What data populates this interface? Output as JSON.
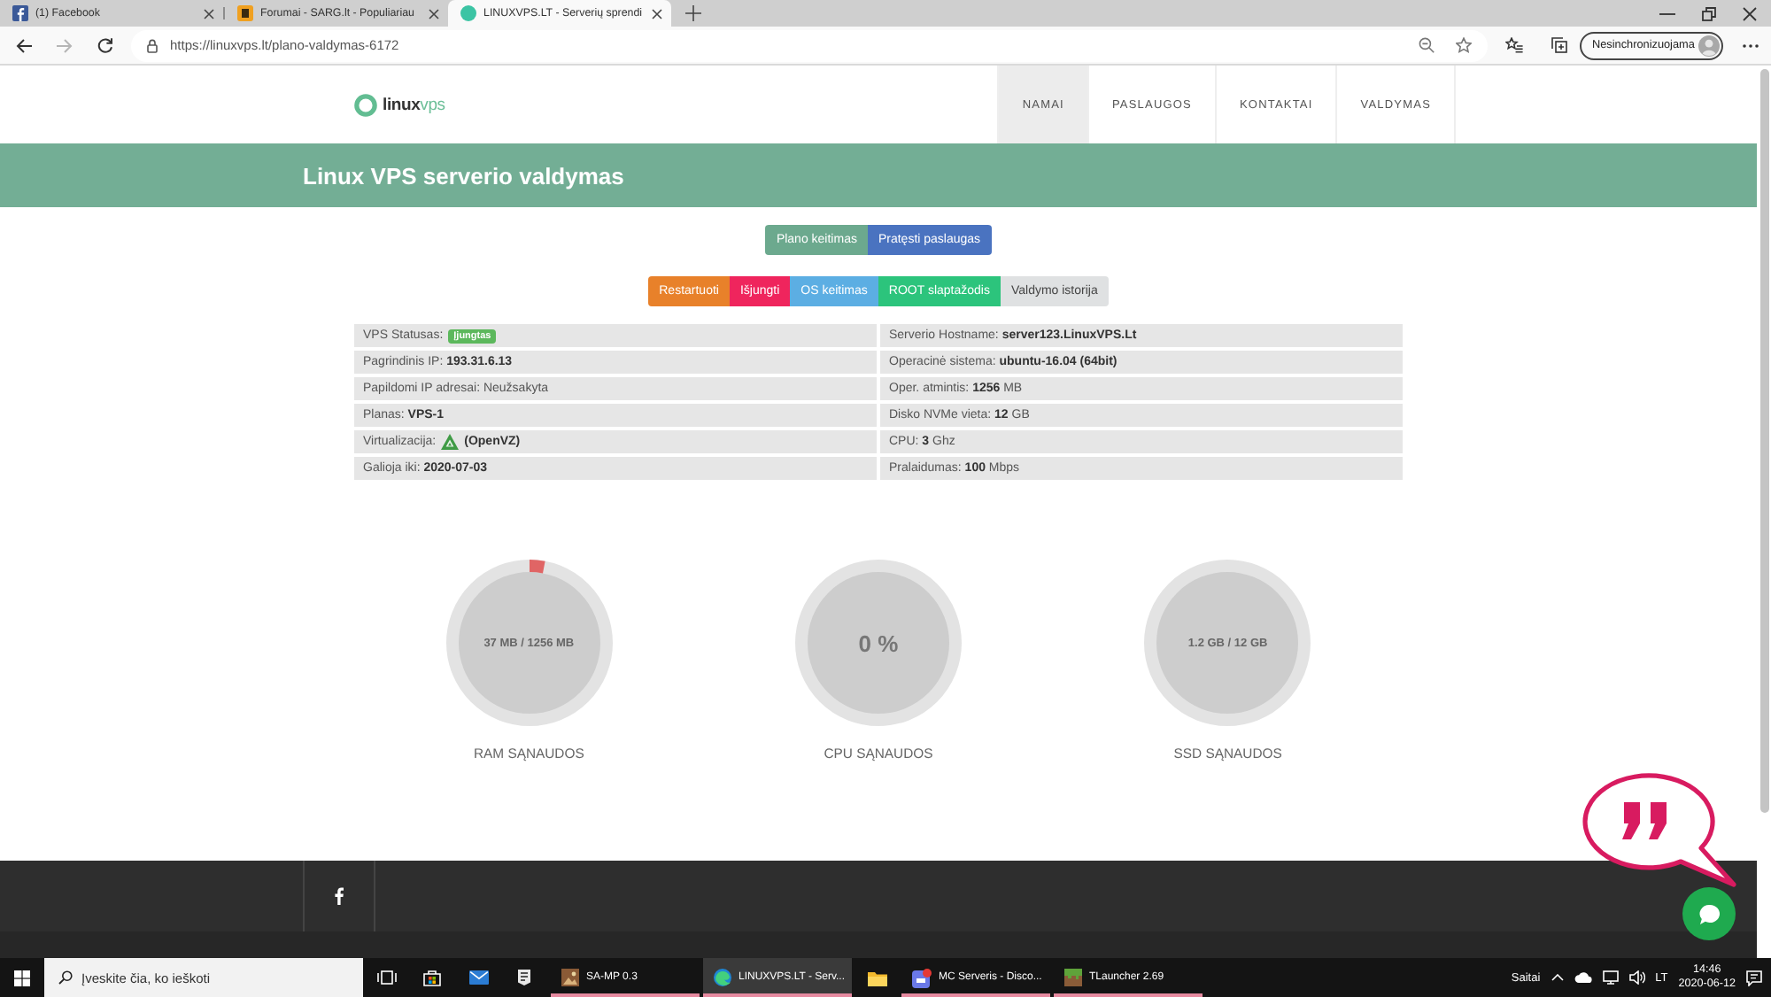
{
  "browser": {
    "tabs": [
      {
        "kind": "letter",
        "title": "(1) Facebook",
        "selected": false
      },
      {
        "kind": "tile",
        "title": "Forumai - SARG.lt - Populiariau",
        "selected": false
      },
      {
        "kind": "dot",
        "title": "LINUXVPS.LT - Serverių sprendi",
        "selected": true
      }
    ],
    "url": "https://linuxvps.lt/plano-valdymas-6172",
    "profile": "Nesinchronizuojama"
  },
  "site": {
    "logo": "**linux**vps",
    "nav": [
      {
        "label": "NAMAI",
        "selected": true
      },
      {
        "label": "PASLAUGOS",
        "selected": false
      },
      {
        "label": "KONTAKTAI",
        "selected": false
      },
      {
        "label": "VALDYMAS",
        "selected": false
      }
    ],
    "title": "Linux VPS serverio valdymas",
    "plan_buttons": [
      {
        "label": "Plano keitimas",
        "color": "#6ca98e"
      },
      {
        "label": "Pratęsti paslaugas",
        "color": "#4a73c0"
      }
    ],
    "action_buttons": [
      {
        "label": "Restartuoti",
        "color": "#e8812a"
      },
      {
        "label": "Išjungti",
        "color": "#ef255d"
      },
      {
        "label": "OS keitimas",
        "color": "#5caee3"
      },
      {
        "label": "ROOT slaptažodis",
        "color": "#2cc47c"
      },
      {
        "label": "Valdymo istorija",
        "color": "#dfe1e2"
      }
    ],
    "info": [
      [
        {
          "kind": "status",
          "label": "VPS Statusas:",
          "badge": "Įjungtas"
        },
        {
          "kind": "text",
          "text": "Serverio Hostname: **server123.LinuxVPS.Lt**"
        }
      ],
      [
        {
          "kind": "text",
          "text": "Pagrindinis IP: **193.31.6.13**"
        },
        {
          "kind": "text",
          "text": "Operacinė sistema: **ubuntu-16.04 (64bit)**"
        }
      ],
      [
        {
          "kind": "text",
          "text": "Papildomi IP adresai: Neužsakyta"
        },
        {
          "kind": "text",
          "text": "Oper. atmintis: **1256** MB"
        }
      ],
      [
        {
          "kind": "text",
          "text": "Planas: **VPS-1**"
        },
        {
          "kind": "text",
          "text": "Disko NVMe vieta: **12** GB"
        }
      ],
      [
        {
          "kind": "virtualization",
          "label": "Virtualizacija:",
          "value": "(OpenVZ)"
        },
        {
          "kind": "text",
          "text": "CPU: **3** Ghz"
        }
      ],
      [
        {
          "kind": "text",
          "text": "Galioja iki: **2020-07-03**"
        },
        {
          "kind": "text",
          "text": "Pralaidumas: **100** Mbps"
        }
      ]
    ],
    "gauges": [
      {
        "kind": "amount",
        "value": "37 MB / 1256 MB",
        "label": "RAM SĄNAUDOS",
        "level": 0.03
      },
      {
        "kind": "percent",
        "value": "0 %",
        "label": "CPU SĄNAUDOS"
      },
      {
        "kind": "amount",
        "value": "1.2 GB / 12 GB",
        "label": "SSD SĄNAUDOS"
      }
    ]
  },
  "taskbar": {
    "search_placeholder": "Įveskite čia, ko ieškoti",
    "apps": [
      {
        "kind": "picture",
        "title": "SA-MP 0.3",
        "selected": false,
        "running": true
      },
      {
        "kind": "swirl",
        "title": "LINUXVPS.LT - Serv...",
        "selected": true,
        "running": true
      },
      {
        "kind": "folder",
        "selected": false,
        "running": false
      },
      {
        "kind": "badged",
        "title": "MC Serveris - Disco...",
        "selected": false,
        "running": true
      },
      {
        "kind": "block",
        "title": "TLauncher 2.69",
        "selected": false,
        "running": true
      }
    ],
    "tray": {
      "links_label": "Saitai",
      "language": "LT",
      "time": "14:46",
      "date": "2020-06-12"
    }
  }
}
